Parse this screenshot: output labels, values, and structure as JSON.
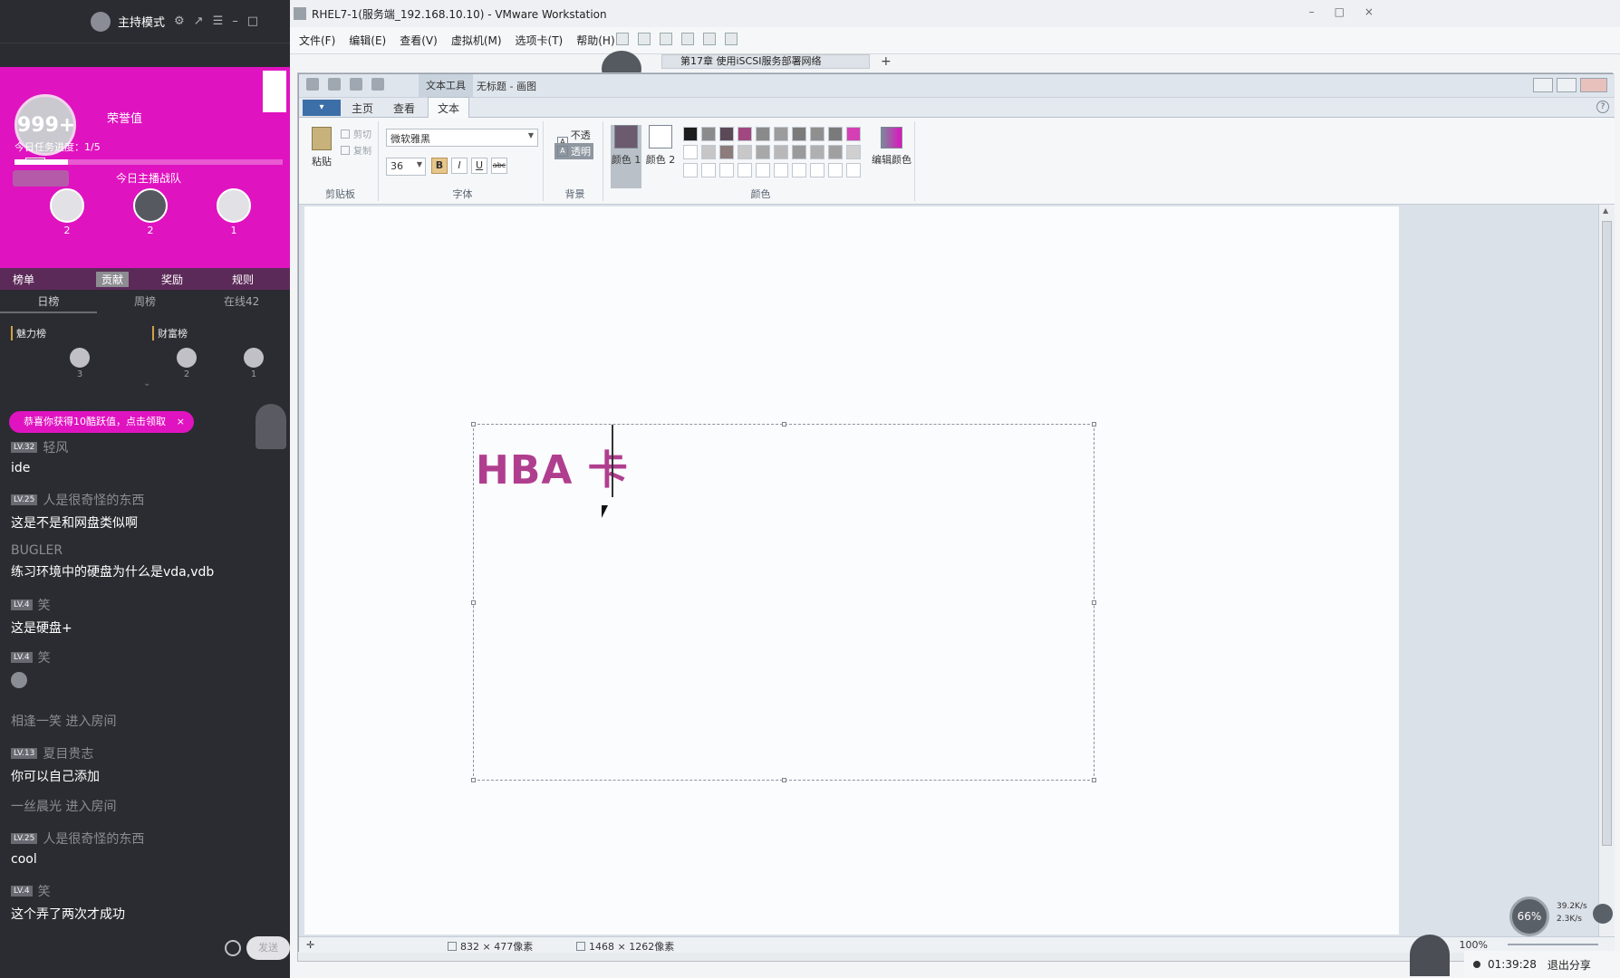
{
  "live": {
    "mode_title": "主持模式",
    "subbar_text": "",
    "level": "999+",
    "level_badge": "",
    "honor": "荣誉值",
    "task_progress": "今日任务进度：1/5",
    "task_fraction": 0.2,
    "team_title": "今日主播战队",
    "team_members": [
      {
        "count": "2"
      },
      {
        "count": "2"
      },
      {
        "count": "1"
      }
    ],
    "actions": [
      "榜单",
      "贡献",
      "奖励",
      "规则"
    ],
    "rank_tabs": [
      "日榜",
      "周榜",
      "在线42"
    ],
    "boards": {
      "charm_label": "魅力榜",
      "wealth_label": "财富榜",
      "faces": [
        {
          "count": "3"
        },
        {
          "count": "2"
        },
        {
          "count": "1"
        }
      ]
    },
    "bonus_text": "恭喜你获得10酷跃值，点击领取",
    "bonus_close": "×",
    "chat": [
      {
        "lv": "LV.32",
        "user": "轻风",
        "text": "ide"
      },
      {
        "lv": "LV.25",
        "user": "人是很奇怪的东西",
        "text": "这是不是和网盘类似啊"
      },
      {
        "lv": "",
        "user": "BUGLER",
        "text": "练习环境中的硬盘为什么是vda,vdb"
      },
      {
        "lv": "LV.4",
        "user": "笑",
        "text": "这是硬盘+"
      },
      {
        "lv": "LV.4",
        "user": "笑",
        "text": ""
      },
      {
        "enter": "相逢一笑 进入房间"
      },
      {
        "lv": "LV.13",
        "user": "夏目贵志",
        "text": "你可以自己添加"
      },
      {
        "enter": "一丝晨光 进入房间"
      },
      {
        "lv": "LV.25",
        "user": "人是很奇怪的东西",
        "text": "cool"
      },
      {
        "lv": "LV.4",
        "user": "笑",
        "text": "这个弄了两次才成功"
      }
    ],
    "chat_input_placeholder": "发送"
  },
  "vmware": {
    "title": "RHEL7-1(服务端_192.168.10.10) - VMware Workstation",
    "menu": [
      "文件(F)",
      "编辑(E)",
      "查看(V)",
      "虚拟机(M)",
      "选项卡(T)",
      "帮助(H)"
    ],
    "tab_label": "第17章 使用iSCSI服务部署网络"
  },
  "paint": {
    "tool_tab": "文本工具",
    "doc_title": "无标题 - 画图",
    "ribbon_tabs": [
      "主页",
      "查看",
      "文本"
    ],
    "clipboard": {
      "paste": "粘贴",
      "cut": "剪切",
      "copy": "复制",
      "label": "剪贴板"
    },
    "font": {
      "family": "微软雅黑",
      "size": "36",
      "label": "字体",
      "bold": "B",
      "italic": "I",
      "underline": "U",
      "strike": "abc"
    },
    "background": {
      "opaque": "不透明",
      "transparent": "透明",
      "label": "背景"
    },
    "colors": {
      "color1_label": "颜色 1",
      "color2_label": "颜色 2",
      "edit_label": "编辑颜色",
      "label": "颜色",
      "color1": "#6c5a6e",
      "color2": "#ffffff",
      "swatches": [
        "#1c1c1c",
        "#8b8b8b",
        "#5a4a58",
        "#a0487f",
        "#8a8a8a",
        "#9c9c9c",
        "#7b7b7b",
        "#8f8f8f",
        "#7a7a7a",
        "#d43fb4",
        "#ffffff",
        "#c6c6c6",
        "#8c7c7c",
        "#c8c8c8",
        "#a8a8a8",
        "#b8b8b8",
        "#9a9a9a",
        "#b0b0b0",
        "#a0a0a0",
        "#d0d0d0",
        "#ffffff",
        "#ffffff",
        "#ffffff",
        "#ffffff",
        "#ffffff",
        "#ffffff",
        "#ffffff",
        "#ffffff",
        "#ffffff",
        "#ffffff"
      ]
    },
    "canvas_text": "HBA 卡",
    "status": {
      "selection_size": "832 × 477像素",
      "image_size": "1468 × 1262像素",
      "zoom": "100%"
    }
  },
  "overlay": {
    "cpu": "66%",
    "up_speed": "39.2K/s",
    "down_speed": "2.3K/s",
    "timer": "01:39:28",
    "exit_share": "退出分享"
  }
}
